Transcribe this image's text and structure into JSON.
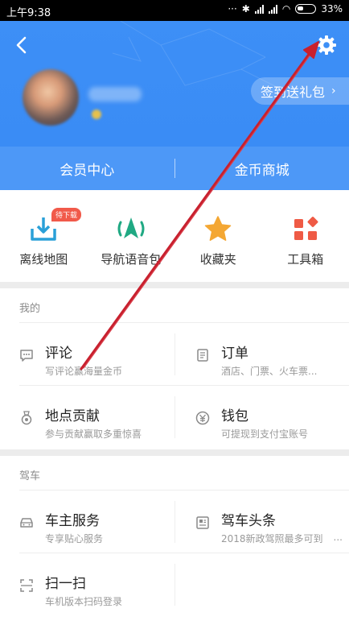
{
  "status_bar": {
    "time": "上午9:38",
    "battery": "33%"
  },
  "header": {
    "checkin_label": "签到送礼包"
  },
  "member_bar": {
    "left_label": "会员中心",
    "right_label": "金币商城"
  },
  "tools": [
    {
      "label": "离线地图",
      "badge": "待下载",
      "icon": "download-map-icon"
    },
    {
      "label": "导航语音包",
      "icon": "voice-navigation-icon"
    },
    {
      "label": "收藏夹",
      "icon": "star-icon"
    },
    {
      "label": "工具箱",
      "icon": "toolbox-icon"
    }
  ],
  "mine": {
    "title": "我的",
    "items": [
      {
        "title": "评论",
        "subtitle": "写评论赢海量金币",
        "icon": "comment-icon"
      },
      {
        "title": "订单",
        "subtitle": "酒店、门票、火车票...",
        "icon": "order-icon"
      },
      {
        "title": "地点贡献",
        "subtitle": "参与贡献赢取多重惊喜",
        "icon": "medal-icon"
      },
      {
        "title": "钱包",
        "subtitle": "可提现到支付宝账号",
        "icon": "wallet-icon"
      }
    ]
  },
  "driving": {
    "title": "驾车",
    "items": [
      {
        "title": "车主服务",
        "subtitle": "专享贴心服务",
        "icon": "car-icon"
      },
      {
        "title": "驾车头条",
        "subtitle": "2018新政驾照最多可到",
        "more": "...",
        "icon": "news-icon"
      },
      {
        "title": "扫一扫",
        "subtitle": "车机版本扫码登录",
        "icon": "scan-icon"
      }
    ]
  },
  "colors": {
    "header_blue": "#3d8ff6",
    "member_bar": "#4d98f7",
    "badge_red": "#f15a4a",
    "arrow_red": "#c8202e"
  }
}
